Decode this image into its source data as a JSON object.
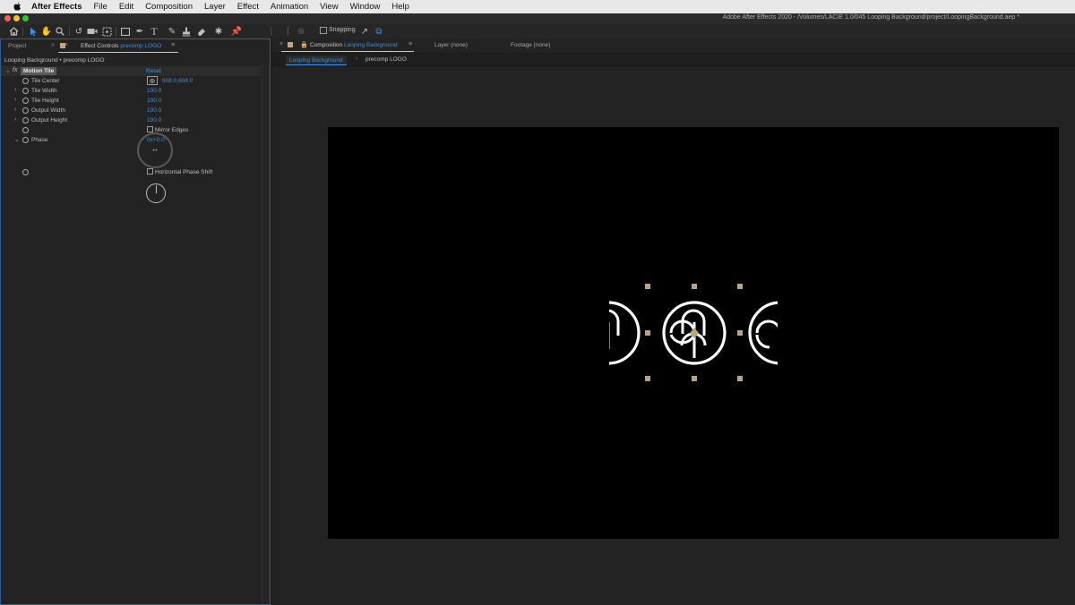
{
  "menubar": {
    "app_name": "After Effects",
    "items": [
      "File",
      "Edit",
      "Composition",
      "Layer",
      "Effect",
      "Animation",
      "View",
      "Window",
      "Help"
    ]
  },
  "window": {
    "title": "Adobe After Effects 2020 - /Volumes/LACIE 1.0/045 Looping Background/project/LoopingBackground.aep *"
  },
  "toolbar": {
    "snapping_label": "Snapping",
    "snapping_checked": false,
    "tools": [
      "home-icon",
      "selection-tool-icon",
      "hand-tool-icon",
      "zoom-tool-icon",
      "rotate-tool-icon",
      "camera-tool-icon",
      "pan-behind-tool-icon",
      "rectangle-tool-icon",
      "pen-tool-icon",
      "type-tool-icon",
      "brush-tool-icon",
      "clone-stamp-tool-icon",
      "eraser-tool-icon",
      "roto-brush-tool-icon",
      "puppet-pin-tool-icon"
    ]
  },
  "left_panel": {
    "tab_project": "Project",
    "tab_effect_controls_prefix": "Effect Controls",
    "tab_effect_controls_layer": "precomp LOGO",
    "subtitle": "Looping Background • precomp LOGO",
    "effect": {
      "name": "Motion Tile",
      "reset_label": "Reset",
      "params": {
        "tile_center": {
          "label": "Tile Center",
          "value": "608.0,608.0"
        },
        "tile_width": {
          "label": "Tile Width",
          "value": "100.0"
        },
        "tile_height": {
          "label": "Tile Height",
          "value": "100.0"
        },
        "output_width": {
          "label": "Output Width",
          "value": "100.0"
        },
        "output_height": {
          "label": "Output Height",
          "value": "100.0"
        },
        "mirror_edges": {
          "label": "Mirror Edges",
          "checked": false
        },
        "phase": {
          "label": "Phase",
          "value": "0x+0.0°"
        },
        "horizontal_phase_shift": {
          "label": "Horizontal Phase Shift",
          "checked": false
        }
      }
    }
  },
  "right_panel": {
    "tab_composition_prefix": "Composition",
    "tab_composition_name": "Looping Background",
    "tab_layer": "Layer (none)",
    "tab_footage": "Footage (none)",
    "flowchart": [
      "Looping Background",
      "precomp LOGO"
    ]
  },
  "colors": {
    "accent_blue": "#3d8fe0",
    "panel_bg": "#232323",
    "handle": "#b8a47e"
  }
}
